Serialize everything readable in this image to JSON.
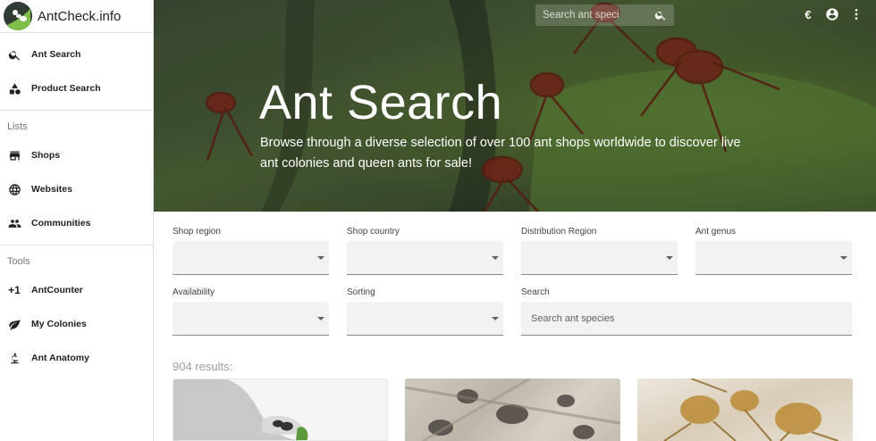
{
  "app": {
    "title": "AntCheck.info"
  },
  "sidebar": {
    "items": [
      {
        "label": "Ant Search",
        "icon": "search-icon"
      },
      {
        "label": "Product Search",
        "icon": "shapes-icon"
      }
    ],
    "lists_header": "Lists",
    "lists": [
      {
        "label": "Shops",
        "icon": "store-icon"
      },
      {
        "label": "Websites",
        "icon": "globe-icon"
      },
      {
        "label": "Communities",
        "icon": "people-icon"
      }
    ],
    "tools_header": "Tools",
    "tools": [
      {
        "label": "AntCounter",
        "icon": "plus-one-icon"
      },
      {
        "label": "My Colonies",
        "icon": "leaf-icon"
      },
      {
        "label": "Ant Anatomy",
        "icon": "microscope-icon"
      }
    ]
  },
  "topbar": {
    "search_placeholder": "Search ant speci",
    "currency": "€"
  },
  "hero": {
    "title": "Ant Search",
    "subtitle": "Browse through a diverse selection of over 100 ant shops worldwide to discover live ant colonies and queen ants for sale!"
  },
  "filters": {
    "shop_region": "Shop region",
    "shop_country": "Shop country",
    "distribution_region": "Distribution Region",
    "ant_genus": "Ant genus",
    "availability": "Availability",
    "sorting": "Sorting",
    "search_label": "Search",
    "search_placeholder": "Search ant species"
  },
  "results": {
    "count_text": "904 results:"
  },
  "colors": {
    "accent_dark": "#212121",
    "divider": "#e0e0e0",
    "field_bg": "#f2f2f2"
  }
}
